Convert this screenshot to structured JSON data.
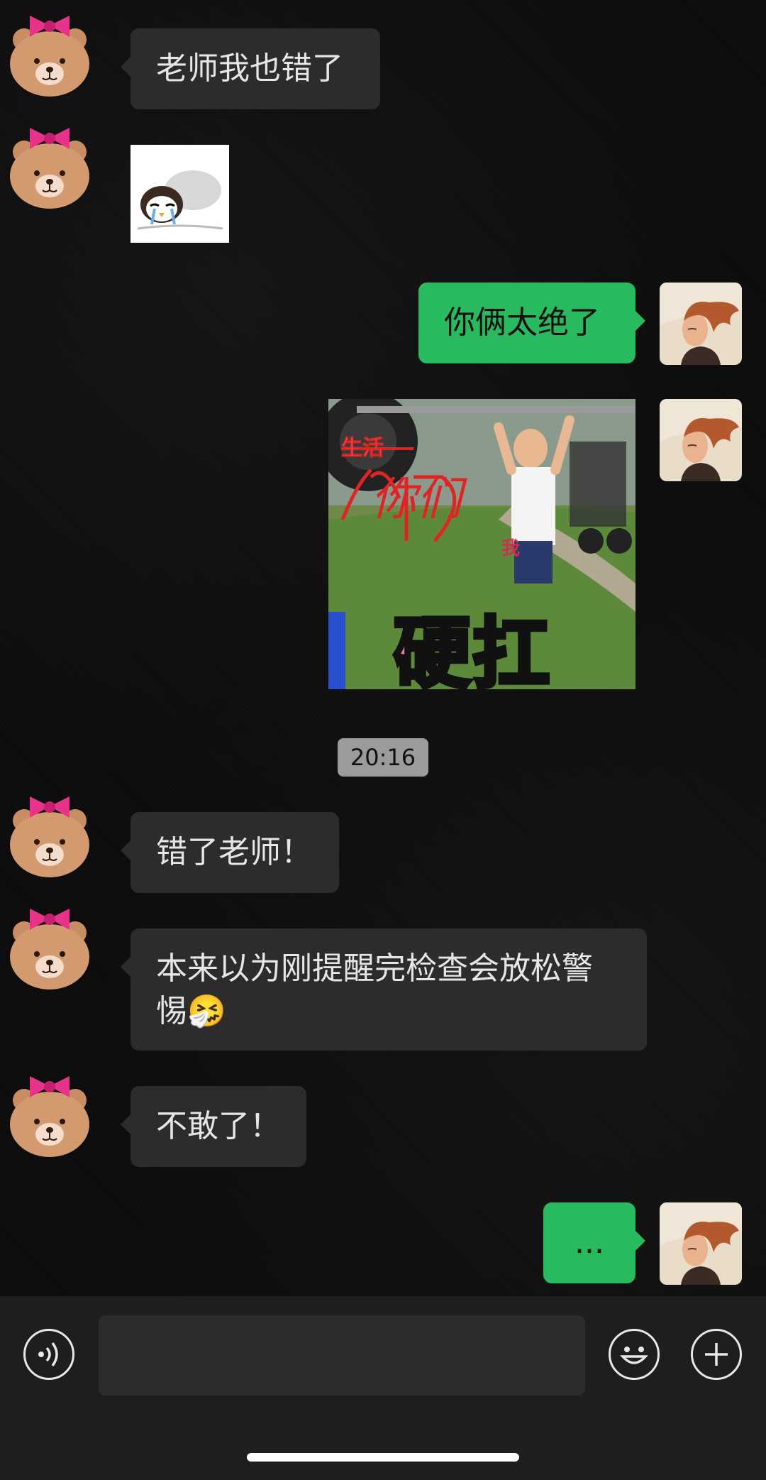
{
  "messages": [
    {
      "side": "in",
      "type": "text",
      "text": "老师我也错了"
    },
    {
      "side": "in",
      "type": "sticker",
      "sticker": "crying-penguin-sticker"
    },
    {
      "side": "out",
      "type": "text",
      "text": "你俩太绝了"
    },
    {
      "side": "out",
      "type": "meme",
      "meme": {
        "crossed_word": "生活",
        "handwritten_word": "你们",
        "small_label": "我",
        "caption": "硬扛"
      }
    },
    {
      "type": "time",
      "text": "20:16"
    },
    {
      "side": "in",
      "type": "text",
      "text": "错了老师！"
    },
    {
      "side": "in",
      "type": "text",
      "line1": "本来以为刚提醒完检查会放松警",
      "line2": "惕",
      "emoji": "🤧"
    },
    {
      "side": "in",
      "type": "text",
      "text": "不敢了！"
    },
    {
      "side": "out",
      "type": "text",
      "text": "..."
    }
  ],
  "input_bar": {
    "voice_icon": "voice-icon",
    "emoji_icon": "smiley-icon",
    "more_icon": "plus-icon",
    "input_value": ""
  },
  "colors": {
    "incoming_bubble": "#2c2c2c",
    "outgoing_bubble": "#29b95e",
    "background": "#0c0c0c"
  }
}
